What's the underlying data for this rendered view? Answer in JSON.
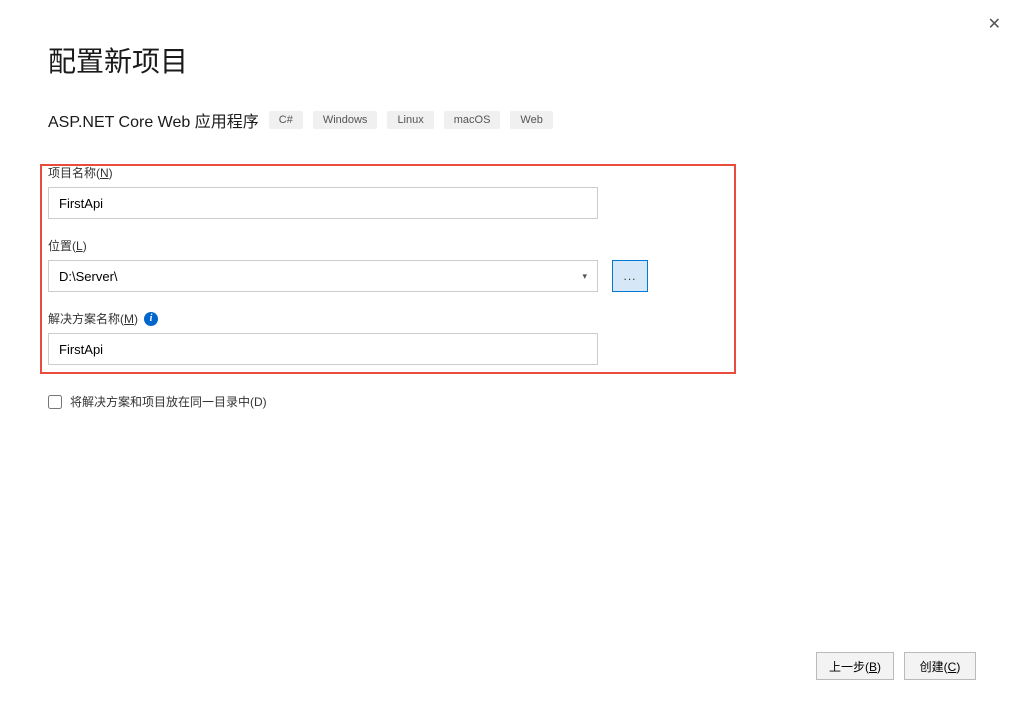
{
  "window": {
    "close_label": "✕"
  },
  "header": {
    "title": "配置新项目",
    "subtitle": "ASP.NET Core Web 应用程序",
    "tags": [
      "C#",
      "Windows",
      "Linux",
      "macOS",
      "Web"
    ]
  },
  "form": {
    "project_name": {
      "label_prefix": "项目名称(",
      "hotkey": "N",
      "label_suffix": ")",
      "value": "FirstApi"
    },
    "location": {
      "label_prefix": "位置(",
      "hotkey": "L",
      "label_suffix": ")",
      "value": "D:\\Server\\",
      "browse_label": "..."
    },
    "solution_name": {
      "label_prefix": "解决方案名称(",
      "hotkey": "M",
      "label_suffix": ")",
      "info_tooltip": "i",
      "value": "FirstApi"
    },
    "same_dir_checkbox": {
      "label_prefix": "将解决方案和项目放在同一目录中(",
      "hotkey": "D",
      "label_suffix": ")",
      "checked": false
    }
  },
  "footer": {
    "back_prefix": "上一步(",
    "back_hotkey": "B",
    "back_suffix": ")",
    "create_prefix": "创建(",
    "create_hotkey": "C",
    "create_suffix": ")"
  }
}
